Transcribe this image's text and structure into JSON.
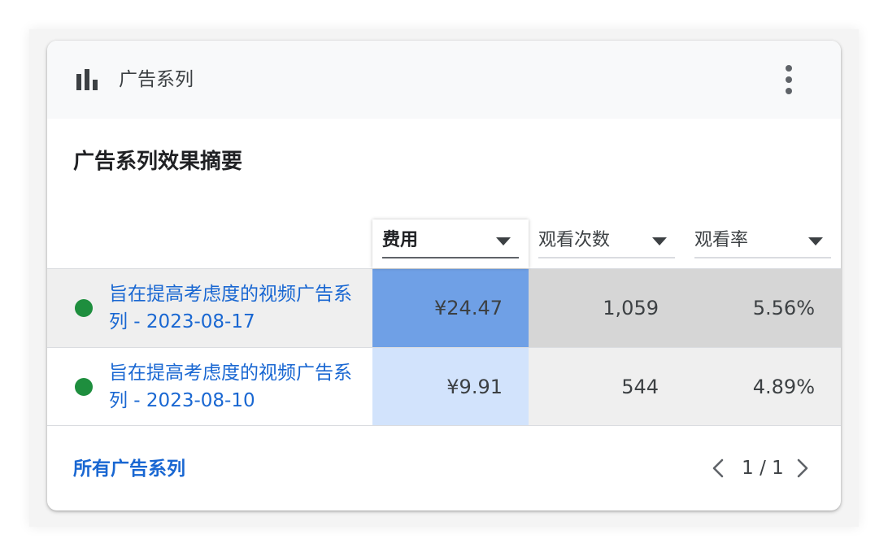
{
  "card": {
    "header_title": "广告系列",
    "section_title": "广告系列效果摘要"
  },
  "columns": [
    {
      "label": "费用",
      "sorted": true
    },
    {
      "label": "观看次数",
      "sorted": false
    },
    {
      "label": "观看率",
      "sorted": false
    }
  ],
  "rows": [
    {
      "status": "enabled",
      "name": "旨在提高考虑度的视频广告系列 - 2023-08-17",
      "cost": "¥24.47",
      "views": "1,059",
      "view_rate": "5.56%"
    },
    {
      "status": "enabled",
      "name": "旨在提高考虑度的视频广告系列 - 2023-08-10",
      "cost": "¥9.91",
      "views": "544",
      "view_rate": "4.89%"
    }
  ],
  "footer": {
    "all_campaigns_link": "所有广告系列",
    "page_indicator": "1 / 1"
  },
  "colors": {
    "link": "#1967d2",
    "status_enabled": "#1e8e3e",
    "cost_heat_high": "#6fa0e6",
    "cost_heat_low": "#d2e3fc",
    "row_highlight": "#d6d6d6",
    "row_normal": "#efefef"
  },
  "icons": {
    "header": "bar-chart-icon",
    "menu": "more-vert-icon",
    "prev": "chevron-left-icon",
    "next": "chevron-right-icon"
  }
}
